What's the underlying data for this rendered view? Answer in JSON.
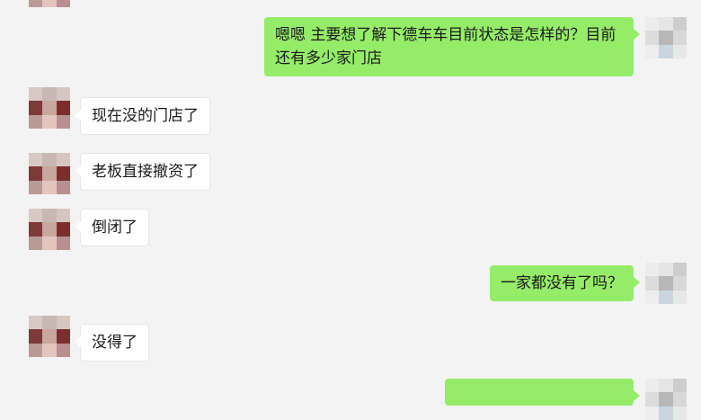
{
  "messages": [
    {
      "side": "out",
      "text": "嗯嗯 主要想了解下德车车目前状态是怎样的？目前还有多少家门店"
    },
    {
      "side": "in",
      "text": "现在没的门店了"
    },
    {
      "side": "in",
      "text": "老板直接撤资了"
    },
    {
      "side": "in",
      "text": "倒闭了"
    },
    {
      "side": "out",
      "text": "一家都没有了吗？"
    },
    {
      "side": "in",
      "text": "没得了"
    }
  ],
  "avatars": {
    "contact": {
      "name": "contact-avatar-icon",
      "pixels": [
        "#d8c9c6",
        "#c9b7b3",
        "#d6c6c2",
        "#7d3a38",
        "#c9a79f",
        "#7b2e30",
        "#b99a97",
        "#e2c6be",
        "#b7908f"
      ]
    },
    "self": {
      "name": "self-avatar-icon",
      "pixels": [
        "#ececec",
        "#e5e5e5",
        "#cdcdcd",
        "#dcdcdc",
        "#b7b7b7",
        "#d8d8d8",
        "#ededed",
        "#c9d6df",
        "#e7e7e7"
      ]
    }
  },
  "colors": {
    "background": "#f3f3f3",
    "bubble_out": "#95ec69",
    "bubble_in": "#ffffff"
  }
}
